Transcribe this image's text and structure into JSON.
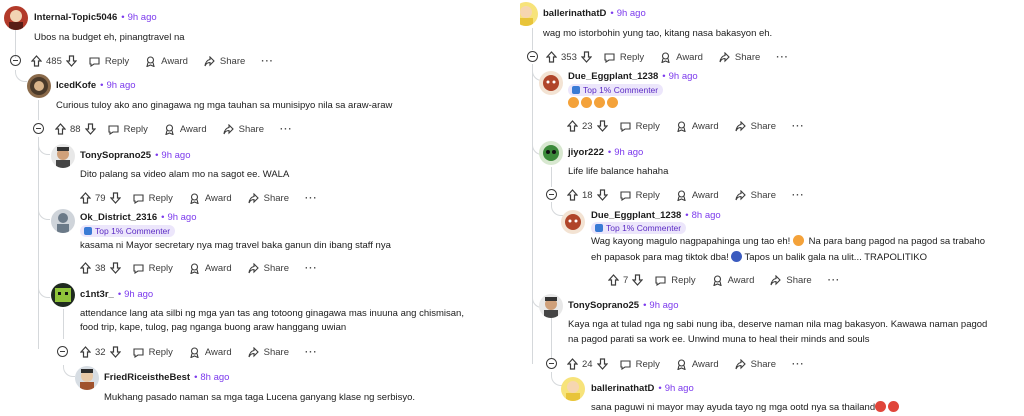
{
  "labels": {
    "reply": "Reply",
    "award": "Award",
    "share": "Share",
    "more": "···",
    "dot": "•",
    "top_commenter": "Top 1% Commenter"
  },
  "colors": {
    "time_accent": "#7c3aed",
    "badge_bg": "#ece6fb",
    "thread_line": "#d5d8db"
  },
  "left": {
    "c1": {
      "user": "Internal-Topic5046",
      "time": "9h ago",
      "text": "Ubos na budget eh, pinangtravel na",
      "votes": "485"
    },
    "c2": {
      "user": "IcedKofe",
      "time": "9h ago",
      "text": "Curious tuloy ako ano ginagawa ng mga tauhan sa munisipyo nila sa araw-araw",
      "votes": "88"
    },
    "c3": {
      "user": "TonySoprano25",
      "time": "9h ago",
      "text": "Dito palang sa video alam mo na sagot ee. WALA",
      "votes": "79"
    },
    "c4": {
      "user": "Ok_District_2316",
      "time": "9h ago",
      "text": "kasama ni Mayor secretary nya mag travel baka ganun din ibang staff nya",
      "votes": "38"
    },
    "c5": {
      "user": "c1nt3r_",
      "time": "9h ago",
      "text1": "attendance lang ata silbi ng mga yan tas ang totoong ginagawa mas inuuna ang chismisan,",
      "text2": "food trip, kape, tulog, pag nganga buong araw hanggang uwian",
      "votes": "32"
    },
    "c6": {
      "user": "FriedRiceistheBest",
      "time": "8h ago",
      "text": "Mukhang pasado naman sa mga taga Lucena ganyang klase ng serbisyo."
    }
  },
  "right": {
    "c1": {
      "user": "ballerinathatD",
      "time": "9h ago",
      "text": "wag mo istorbohin yung tao, kitang nasa bakasyon eh.",
      "votes": "353"
    },
    "c2": {
      "user": "Due_Eggplant_1238",
      "time": "9h ago",
      "votes": "23"
    },
    "c3": {
      "user": "jiyor222",
      "time": "9h ago",
      "text": "Life life balance hahaha",
      "votes": "18"
    },
    "c4": {
      "user": "Due_Eggplant_1238",
      "time": "8h ago",
      "text1": "Wag kayong magulo nagpapahinga ung tao eh!",
      "text1b": "Na para bang pagod na pagod sa trabaho",
      "text2": "eh papasok para mag  tiktok dba!",
      "text2b": "Tapos un balik gala na ulit... TRAPOLITIKO",
      "votes": "7"
    },
    "c5": {
      "user": "TonySoprano25",
      "time": "9h ago",
      "text1": "Kaya nga at tulad nga ng sabi nung iba, deserve naman nila mag bakasyon. Kawawa naman pagod",
      "text2": "na pagod parati sa work ee. Unwind muna to heal their minds and souls",
      "votes": "24"
    },
    "c6": {
      "user": "ballerinathatD",
      "time": "9h ago",
      "text": "sana paguwi ni mayor may ayuda tayo ng mga ootd nya sa thailand"
    }
  }
}
